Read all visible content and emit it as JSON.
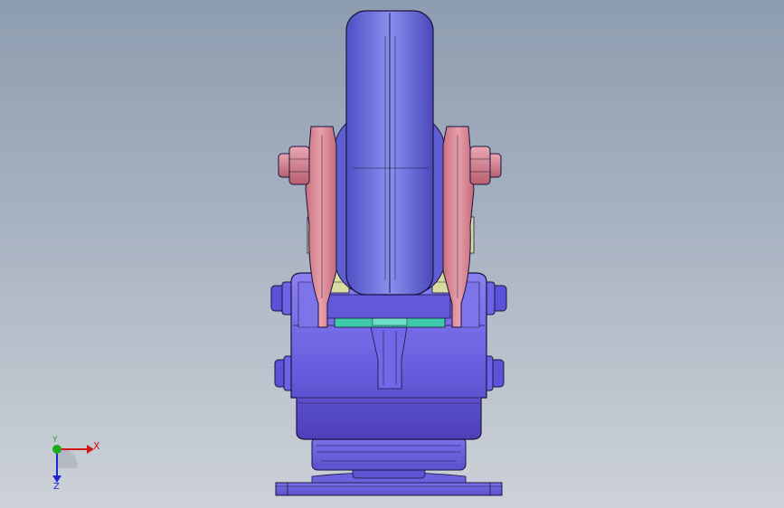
{
  "viewport": {
    "background_top": "#8e9cb0",
    "background_bottom": "#cdd2d8"
  },
  "model": {
    "body_color": "#6a5fe0",
    "wheel_color": "#6f74dd",
    "bracket_color": "#d98a96",
    "spring_color": "#d8dc9e",
    "seal_color": "#3ec9a8",
    "edge_color": "#1a1440"
  },
  "triad": {
    "x_label": "X",
    "y_label": "Y",
    "z_label": "Z",
    "x_color": "#d01818",
    "y_color": "#1ea81e",
    "z_color": "#1a2ad0"
  }
}
